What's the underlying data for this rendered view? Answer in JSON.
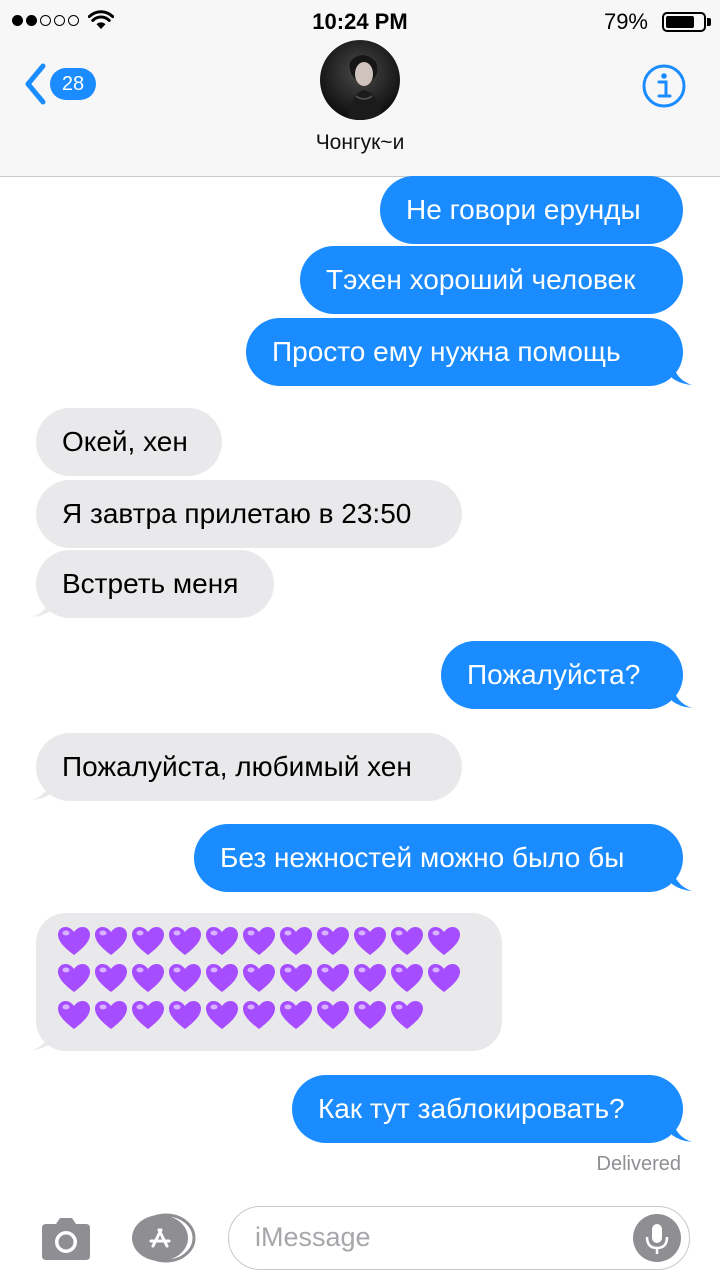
{
  "status_bar": {
    "time": "10:24 PM",
    "battery_percent": "79%",
    "battery_level": 0.79,
    "signal_bars": 2,
    "signal_total": 5
  },
  "nav": {
    "back_count": "28",
    "contact_name": "Чонгук~и"
  },
  "messages": [
    {
      "dir": "out",
      "text": "Не говори ерунды"
    },
    {
      "dir": "out",
      "text": "Тэхен хороший человек"
    },
    {
      "dir": "out",
      "text": "Просто ему нужна помощь"
    },
    {
      "dir": "in",
      "text": "Окей, хен"
    },
    {
      "dir": "in",
      "text": "Я завтра прилетаю в 23:50"
    },
    {
      "dir": "in",
      "text": "Встреть меня"
    },
    {
      "dir": "out",
      "text": "Пожалуйста?"
    },
    {
      "dir": "in",
      "text": "Пожалуйста, любимый хен"
    },
    {
      "dir": "out",
      "text": "Без нежностей можно было бы"
    },
    {
      "dir": "in",
      "text": "💜💜💜💜💜💜💜💜💜💜💜💜💜💜💜💜💜💜💜💜💜💜💜💜💜💜💜💜💜💜💜💜"
    },
    {
      "dir": "out",
      "text": "Как тут заблокировать?"
    }
  ],
  "hearts": {
    "icon": "purple-heart-icon",
    "rows": [
      11,
      11,
      10
    ],
    "color": "#a64dff"
  },
  "delivered_label": "Delivered",
  "input": {
    "placeholder": "iMessage"
  },
  "colors": {
    "accent": "#1a8cff",
    "incoming": "#e9e9eb",
    "muted": "#8e8e93"
  }
}
